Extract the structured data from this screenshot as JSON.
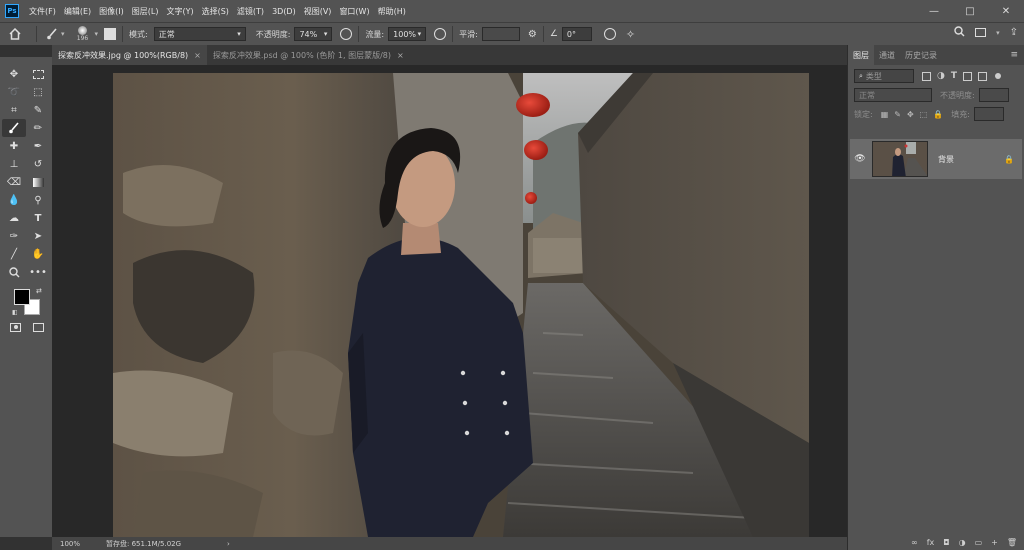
{
  "app": {
    "logo": "Ps"
  },
  "menubar": {
    "items": [
      "文件(F)",
      "编辑(E)",
      "图像(I)",
      "图层(L)",
      "文字(Y)",
      "选择(S)",
      "滤镜(T)",
      "3D(D)",
      "视图(V)",
      "窗口(W)",
      "帮助(H)"
    ]
  },
  "window": {
    "minimize": "—",
    "maximize": "□",
    "close": "✕"
  },
  "options": {
    "brush_size": "196",
    "mode_label": "模式:",
    "mode_value": "正常",
    "opacity_label": "不透明度:",
    "opacity_value": "74%",
    "flow_label": "流量:",
    "flow_value": "100%",
    "smooth_label": "平滑:",
    "angle_value": "0°"
  },
  "tabs": [
    {
      "label": "探索反冲效果.jpg @ 100%(RGB/8)",
      "close": "×"
    },
    {
      "label": "探索反冲效果.psd @ 100% (色阶 1, 图层蒙版/8)",
      "close": "×"
    }
  ],
  "status": {
    "zoom": "100%",
    "info": "暂存盘: 651.1M/5.02G",
    "arrow": "›"
  },
  "panel": {
    "tabs": [
      "图层",
      "通道",
      "历史记录"
    ],
    "kind_placeholder": "类型",
    "blend_mode": "正常",
    "opacity_label": "不透明度:",
    "lock_label": "锁定:",
    "fill_label": "填充:",
    "layer_name": "背景",
    "footer_icons": [
      "∞",
      "fx",
      "◘",
      "◑",
      "▭",
      "+",
      "🗑"
    ]
  },
  "colors": {
    "accent": "#31a8ff",
    "fg": "#000000",
    "bg": "#ffffff"
  }
}
